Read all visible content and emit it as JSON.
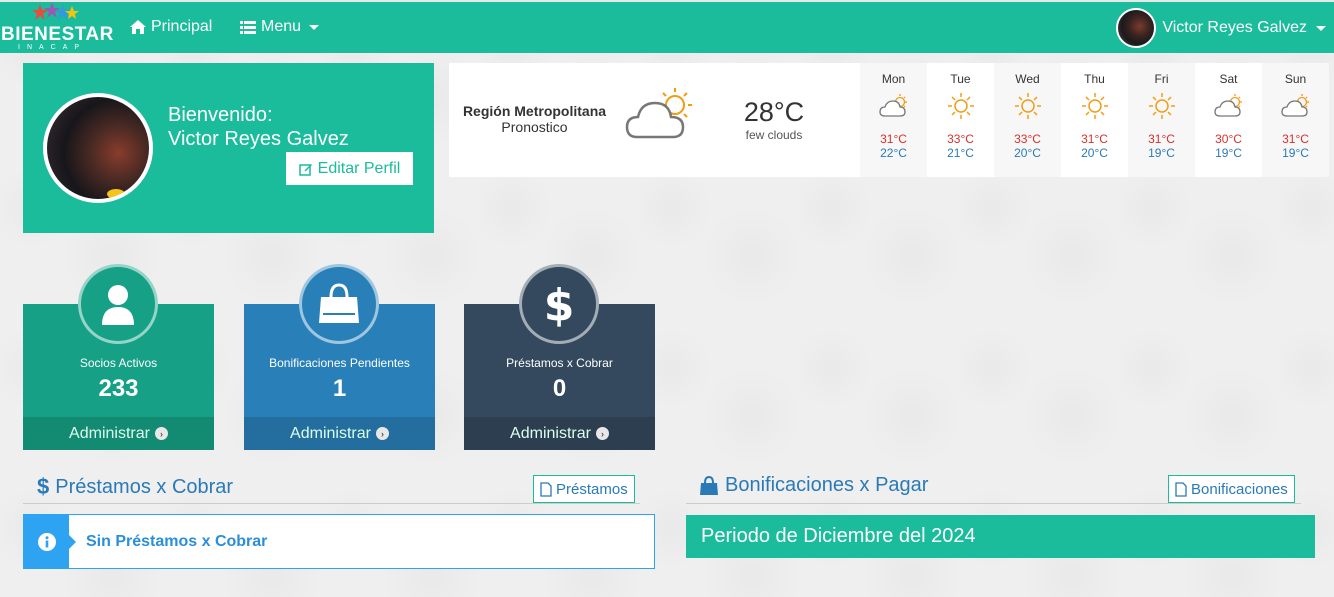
{
  "navbar": {
    "logo_text": "BIENESTAR",
    "logo_sub": "INACAP",
    "links": [
      {
        "label": "Principal",
        "icon": "home-icon"
      },
      {
        "label": "Menu",
        "icon": "list-icon"
      }
    ],
    "user_name": "Victor Reyes Galvez"
  },
  "welcome": {
    "greeting": "Bienvenido:",
    "name": "Victor Reyes Galvez",
    "edit_label": "Editar Perfil"
  },
  "weather": {
    "region": "Región Metropolitana",
    "subtitle": "Pronostico",
    "current_temp": "28°C",
    "current_desc": "few clouds",
    "days": [
      {
        "day": "Mon",
        "icon": "partly-cloudy-icon",
        "hi": "31°C",
        "lo": "22°C"
      },
      {
        "day": "Tue",
        "icon": "sun-icon",
        "hi": "33°C",
        "lo": "21°C"
      },
      {
        "day": "Wed",
        "icon": "sun-icon",
        "hi": "33°C",
        "lo": "20°C"
      },
      {
        "day": "Thu",
        "icon": "sun-icon",
        "hi": "31°C",
        "lo": "20°C"
      },
      {
        "day": "Fri",
        "icon": "sun-icon",
        "hi": "31°C",
        "lo": "19°C"
      },
      {
        "day": "Sat",
        "icon": "partly-cloudy-icon",
        "hi": "30°C",
        "lo": "19°C"
      },
      {
        "day": "Sun",
        "icon": "partly-cloudy-icon",
        "hi": "31°C",
        "lo": "19°C"
      }
    ]
  },
  "tiles": [
    {
      "label": "Socios Activos",
      "value": "233",
      "action": "Administrar",
      "icon": "user-icon",
      "color": "#16a085"
    },
    {
      "label": "Bonificaciones Pendientes",
      "value": "1",
      "action": "Administrar",
      "icon": "shopping-bag-icon",
      "color": "#2980b9"
    },
    {
      "label": "Préstamos x Cobrar",
      "value": "0",
      "action": "Administrar",
      "icon": "dollar-icon",
      "color": "#34495e"
    }
  ],
  "prestamos": {
    "title": "Préstamos x Cobrar",
    "button": "Préstamos",
    "alert": "Sin Préstamos x Cobrar"
  },
  "bonificaciones": {
    "title": "Bonificaciones x Pagar",
    "button": "Bonificaciones",
    "period": "Periodo de Diciembre del 2024"
  },
  "colors": {
    "accent": "#1abc9c",
    "blue": "#2980b9",
    "dark": "#34495e",
    "info": "#2ea3f2"
  }
}
